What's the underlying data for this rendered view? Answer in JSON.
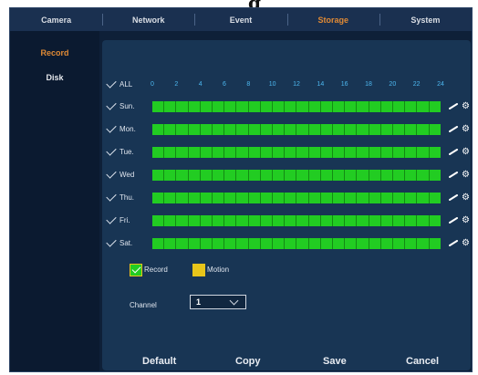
{
  "title_fragment": "g",
  "nav": {
    "tabs": [
      {
        "label": "Camera"
      },
      {
        "label": "Network"
      },
      {
        "label": "Event"
      },
      {
        "label": "Storage"
      },
      {
        "label": "System"
      }
    ],
    "active": "Storage"
  },
  "sidebar": {
    "items": [
      {
        "label": "Record"
      },
      {
        "label": "Disk"
      }
    ],
    "active": "Record"
  },
  "schedule": {
    "all_label": "ALL",
    "hours": [
      "0",
      "2",
      "4",
      "6",
      "8",
      "10",
      "12",
      "14",
      "16",
      "18",
      "20",
      "22",
      "24"
    ],
    "days": [
      {
        "label": "Sun.",
        "checked": true
      },
      {
        "label": "Mon.",
        "checked": true
      },
      {
        "label": "Tue.",
        "checked": true
      },
      {
        "label": "Wed",
        "checked": true
      },
      {
        "label": "Thu.",
        "checked": true
      },
      {
        "label": "Fri.",
        "checked": true
      },
      {
        "label": "Sat.",
        "checked": true
      }
    ],
    "segments_per_day": 24,
    "record_color": "#22cc22",
    "motion_color": "#e8c51a"
  },
  "legend": {
    "record_label": "Record",
    "motion_label": "Motion"
  },
  "channel": {
    "label": "Channel",
    "value": "1"
  },
  "buttons": {
    "default_label": "Default",
    "copy_label": "Copy",
    "save_label": "Save",
    "cancel_label": "Cancel"
  }
}
